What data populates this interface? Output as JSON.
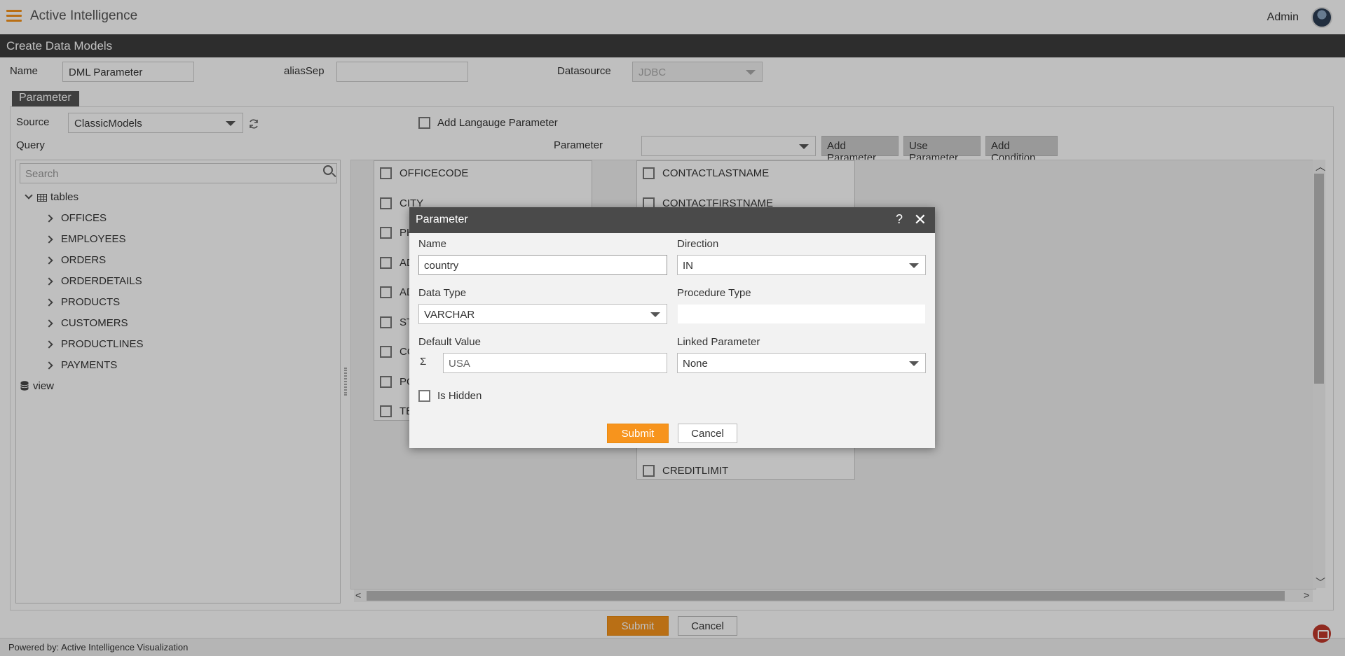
{
  "app": {
    "title": "Active Intelligence",
    "user": "Admin"
  },
  "page": {
    "title": "Create Data Models"
  },
  "form": {
    "name_label": "Name",
    "name_value": "DML Parameter",
    "alias_label": "aliasSep",
    "alias_value": "",
    "datasource_label": "Datasource",
    "datasource_value": "JDBC"
  },
  "param_tab": "Parameter",
  "source": {
    "label": "Source",
    "value": "ClassicModels"
  },
  "add_language": "Add Langauge Parameter",
  "query_label": "Query",
  "parameter_label": "Parameter",
  "parameter_value": "",
  "buttons": {
    "add_parameter": "Add Parameter",
    "use_parameter": "Use Parameter",
    "add_condition": "Add Condition",
    "submit": "Submit",
    "cancel": "Cancel"
  },
  "tree": {
    "search_placeholder": "Search",
    "tables_label": "tables",
    "tables": [
      "OFFICES",
      "EMPLOYEES",
      "ORDERS",
      "ORDERDETAILS",
      "PRODUCTS",
      "CUSTOMERS",
      "PRODUCTLINES",
      "PAYMENTS"
    ],
    "view_label": "view"
  },
  "canvas": {
    "offices_columns": [
      "OFFICECODE",
      "CITY",
      "PH",
      "AD",
      "AD",
      "ST",
      "CO",
      "PO",
      "TE"
    ],
    "customers_columns": [
      "CONTACTLASTNAME",
      "CONTACTFIRSTNAME",
      "CREDITLIMIT"
    ]
  },
  "dialog": {
    "title": "Parameter",
    "help": "?",
    "close": "✕",
    "name_label": "Name",
    "name_value": "country",
    "direction_label": "Direction",
    "direction_value": "IN",
    "datatype_label": "Data Type",
    "datatype_value": "VARCHAR",
    "proc_type_label": "Procedure Type",
    "proc_type_value": "",
    "default_label": "Default Value",
    "default_prefix": "Σ",
    "default_value": "USA",
    "linked_label": "Linked Parameter",
    "linked_value": "None",
    "hidden_label": "Is Hidden",
    "submit": "Submit",
    "cancel": "Cancel"
  },
  "footer": {
    "powered": "Powered by: Active Intelligence Visualization"
  },
  "colors": {
    "accent": "#f7941d",
    "header": "#3c3c3c"
  }
}
